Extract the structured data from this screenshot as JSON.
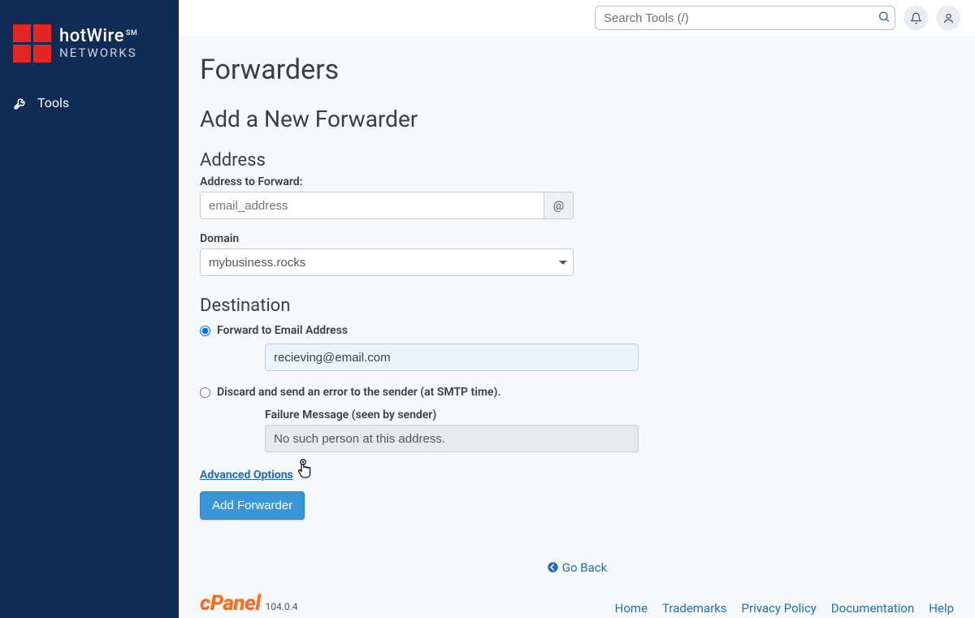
{
  "brand": {
    "name": "hotWire",
    "subtitle": "NETWORKS",
    "mark": "SM"
  },
  "sidebar": {
    "tools_label": "Tools"
  },
  "topbar": {
    "search_placeholder": "Search Tools (/)"
  },
  "page": {
    "title": "Forwarders",
    "section_title": "Add a New Forwarder",
    "address_heading": "Address",
    "address_label": "Address to Forward:",
    "address_placeholder": "email_address",
    "at_symbol": "@",
    "domain_label": "Domain",
    "domain_value": "mybusiness.rocks",
    "destination_heading": "Destination",
    "radio_forward_label": "Forward to Email Address",
    "forward_value": "recieving@email.com",
    "radio_discard_label": "Discard and send an error to the sender (at SMTP time).",
    "failure_label": "Failure Message (seen by sender)",
    "failure_value": "No such person at this address.",
    "advanced_label": "Advanced Options",
    "submit_label": "Add Forwarder",
    "goback_label": "Go Back"
  },
  "footer": {
    "product": "cPanel",
    "version": "104.0.4",
    "links": [
      "Home",
      "Trademarks",
      "Privacy Policy",
      "Documentation",
      "Help"
    ]
  }
}
